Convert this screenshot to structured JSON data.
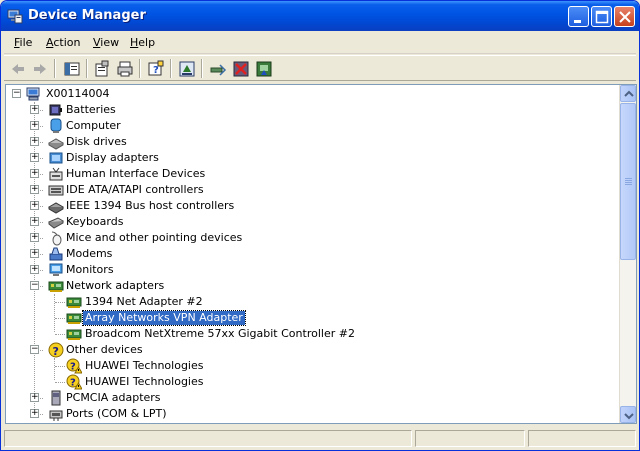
{
  "window": {
    "title": "Device Manager",
    "app_icon": "device-manager-icon"
  },
  "menu": {
    "file": "File",
    "action": "Action",
    "view": "View",
    "help": "Help"
  },
  "toolbar": {
    "buttons": [
      "back-icon",
      "forward-icon",
      "show-hide-tree-icon",
      "properties-icon",
      "print-icon",
      "help-icon",
      "update-driver-icon",
      "scan-hardware-icon",
      "disable-device-icon",
      "uninstall-device-icon"
    ]
  },
  "tree": {
    "root": "X00114004",
    "items": [
      {
        "label": "Batteries",
        "icon": "battery-icon",
        "expanded": false
      },
      {
        "label": "Computer",
        "icon": "computer-icon",
        "expanded": false
      },
      {
        "label": "Disk drives",
        "icon": "disk-drive-icon",
        "expanded": false
      },
      {
        "label": "Display adapters",
        "icon": "display-adapter-icon",
        "expanded": false
      },
      {
        "label": "Human Interface Devices",
        "icon": "hid-icon",
        "expanded": false
      },
      {
        "label": "IDE ATA/ATAPI controllers",
        "icon": "ide-controller-icon",
        "expanded": false
      },
      {
        "label": "IEEE 1394 Bus host controllers",
        "icon": "ieee1394-icon",
        "expanded": false
      },
      {
        "label": "Keyboards",
        "icon": "keyboard-icon",
        "expanded": false
      },
      {
        "label": "Mice and other pointing devices",
        "icon": "mouse-icon",
        "expanded": false
      },
      {
        "label": "Modems",
        "icon": "modem-icon",
        "expanded": false
      },
      {
        "label": "Monitors",
        "icon": "monitor-icon",
        "expanded": false
      },
      {
        "label": "Network adapters",
        "icon": "network-adapter-icon",
        "expanded": true,
        "children": [
          {
            "label": "1394 Net Adapter #2",
            "icon": "network-card-icon"
          },
          {
            "label": "Array Networks VPN Adapter",
            "icon": "network-card-icon",
            "selected": true
          },
          {
            "label": "Broadcom NetXtreme 57xx Gigabit Controller #2",
            "icon": "network-card-icon"
          }
        ]
      },
      {
        "label": "Other devices",
        "icon": "unknown-device-icon",
        "expanded": true,
        "children": [
          {
            "label": "HUAWEI Technologies",
            "icon": "warning-device-icon"
          },
          {
            "label": "HUAWEI Technologies",
            "icon": "warning-device-icon"
          }
        ]
      },
      {
        "label": "PCMCIA adapters",
        "icon": "pcmcia-icon",
        "expanded": false
      },
      {
        "label": "Ports (COM & LPT)",
        "icon": "port-icon",
        "expanded": false
      }
    ]
  },
  "colors": {
    "title_bar": "#0055e5",
    "selection": "#316ac5",
    "window_bg": "#ece9d8"
  }
}
